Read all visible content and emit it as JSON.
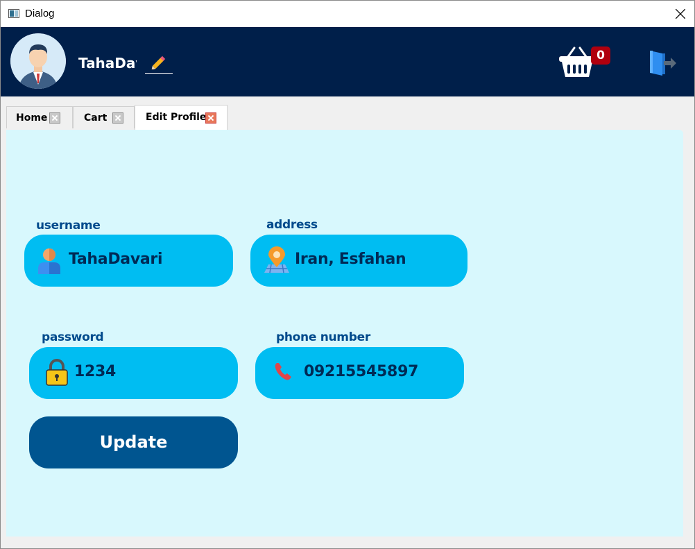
{
  "window": {
    "title": "Dialog"
  },
  "header": {
    "username": "TahaDavari",
    "cart_count": "0"
  },
  "tabs": [
    {
      "label": "Home",
      "active": false
    },
    {
      "label": "Cart",
      "active": false
    },
    {
      "label": "Edit Profile",
      "active": true
    }
  ],
  "form": {
    "username": {
      "label": "username",
      "value": "TahaDavari",
      "icon": "user-icon"
    },
    "address": {
      "label": "address",
      "value": "Iran, Esfahan",
      "icon": "map-pin-icon"
    },
    "password": {
      "label": "password",
      "value": "1234",
      "icon": "lock-icon"
    },
    "phone": {
      "label": "phone number",
      "value": "09215545897",
      "icon": "phone-icon"
    },
    "update_label": "Update"
  },
  "colors": {
    "header_bg": "#001f4a",
    "content_bg": "#d8f8fd",
    "field_bg": "#00bdf2",
    "label_color": "#004a8c",
    "button_bg": "#005590",
    "badge_bg": "#b0000e"
  }
}
